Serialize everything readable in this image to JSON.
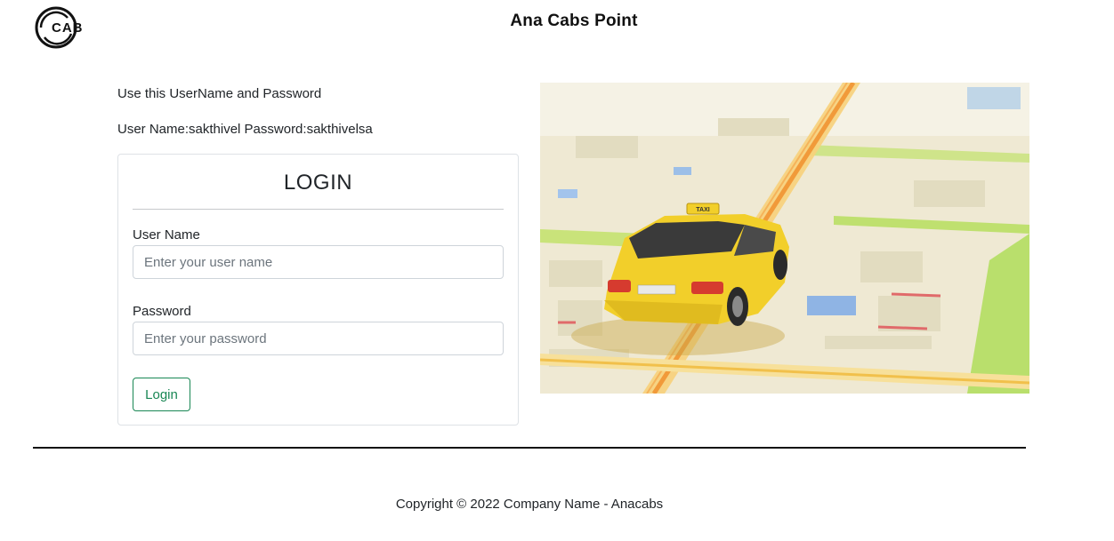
{
  "header": {
    "logo_text": "CAB",
    "site_title": "Ana Cabs Point"
  },
  "hints": {
    "line1": "Use this UserName and Password",
    "line2": "User Name:sakthivel Password:sakthivelsa"
  },
  "login_card": {
    "title": "LOGIN",
    "username_label": "User Name",
    "username_placeholder": "Enter your user name",
    "username_value": "",
    "password_label": "Password",
    "password_placeholder": "Enter your password",
    "password_value": "",
    "submit_label": "Login"
  },
  "hero_image": {
    "subject": "yellow taxi on city map",
    "taxi_sign": "TAXI"
  },
  "footer": {
    "copyright": "Copyright © 2022 Company Name - Anacabs"
  },
  "colors": {
    "primary_text": "#212529",
    "success_green": "#198754",
    "border": "#dee2e6",
    "placeholder": "#6c757d",
    "taxi_yellow": "#f2cf2a"
  }
}
